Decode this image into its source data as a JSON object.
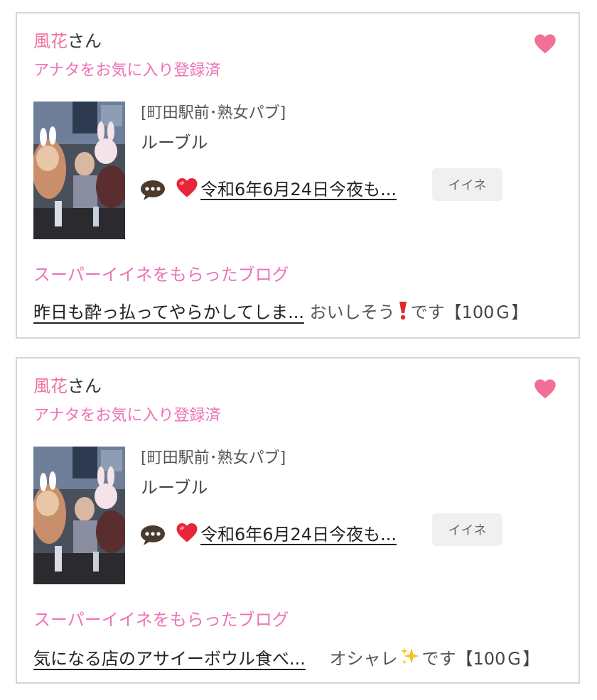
{
  "cards": [
    {
      "user_name": "風花",
      "honorific": "さん",
      "favorite_status": "アナタをお気に入り登録済",
      "shop_area": "[町田駅前･熟女パブ]",
      "shop_name": "ルーブル",
      "blog_title": "令和6年6月24日今夜も...",
      "iine_label": "イイネ",
      "section_label": "スーパーイイネをもらったブログ",
      "super_blog_title": "昨日も酔っ払ってやらかしてしま...",
      "super_comment_pre": "おいしそう",
      "super_comment_emoji": "exclamation-icon",
      "super_comment_post": "です",
      "super_points": "【100Ｇ】"
    },
    {
      "user_name": "風花",
      "honorific": "さん",
      "favorite_status": "アナタをお気に入り登録済",
      "shop_area": "[町田駅前･熟女パブ]",
      "shop_name": "ルーブル",
      "blog_title": "令和6年6月24日今夜も...",
      "iine_label": "イイネ",
      "section_label": "スーパーイイネをもらったブログ",
      "super_blog_title": "気になる店のアサイーボウル食べ...",
      "super_comment_pre": "オシャレ",
      "super_comment_emoji": "sparkles-icon",
      "super_comment_post": "です",
      "super_points": "【100Ｇ】"
    }
  ],
  "colors": {
    "user_name": "#f0759a",
    "accent_pink": "#ee72b6",
    "heart": "#f26f96",
    "card_border": "#d6d6d6",
    "iine_bg": "#f0f0f0"
  }
}
